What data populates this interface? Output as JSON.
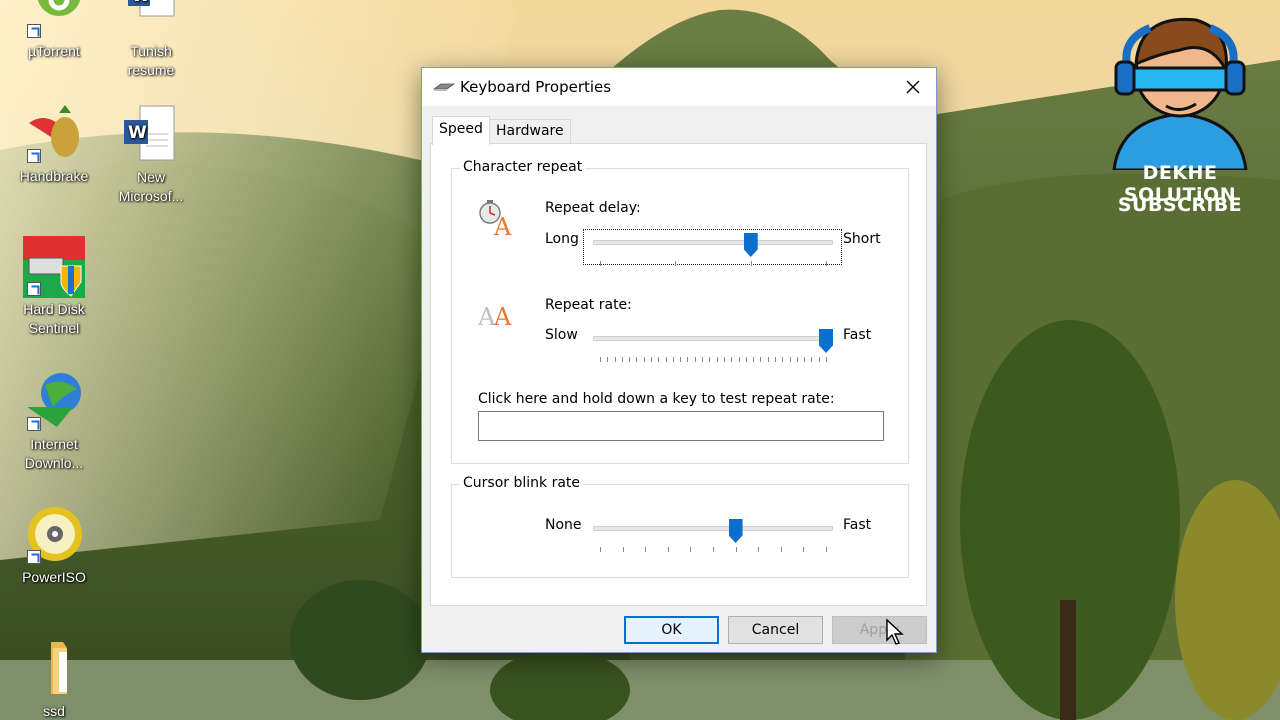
{
  "desktop": {
    "icons": [
      {
        "label_1": "µTorrent",
        "label_2": ""
      },
      {
        "label_1": "Tunish",
        "label_2": "resume"
      },
      {
        "label_1": "Handbrake",
        "label_2": ""
      },
      {
        "label_1": "New",
        "label_2": "Microsof..."
      },
      {
        "label_1": "Hard Disk",
        "label_2": "Sentinel"
      },
      {
        "label_1": "Internet",
        "label_2": "Downlo..."
      },
      {
        "label_1": "PowerISO",
        "label_2": ""
      },
      {
        "label_1": "ssd",
        "label_2": ""
      }
    ]
  },
  "badge": {
    "line1": "DEKHE SOLUTiON",
    "line2": "SUBSCRiBE"
  },
  "dialog": {
    "title": "Keyboard Properties",
    "tabs": [
      {
        "label": "Speed",
        "selected": true
      },
      {
        "label": "Hardware",
        "selected": false
      }
    ],
    "character_repeat": {
      "group_title": "Character repeat",
      "delay": {
        "label": "Repeat delay:",
        "min_label": "Long",
        "max_label": "Short",
        "value": 0.667,
        "tick_count": 4
      },
      "rate": {
        "label": "Repeat rate:",
        "min_label": "Slow",
        "max_label": "Fast",
        "value": 1.0,
        "tick_count": 32
      },
      "test_label": "Click here and hold down a key to test repeat rate:",
      "test_value": ""
    },
    "cursor_blink": {
      "group_title": "Cursor blink rate",
      "min_label": "None",
      "max_label": "Fast",
      "value": 0.6,
      "tick_count": 11
    },
    "buttons": {
      "ok": "OK",
      "cancel": "Cancel",
      "apply": "Apply"
    }
  },
  "colors": {
    "accent": "#0a6fcf",
    "disabled_text": "#a0a0a0"
  }
}
